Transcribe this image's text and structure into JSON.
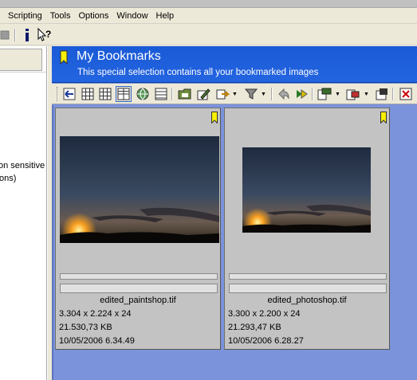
{
  "menu": [
    "Scripting",
    "Tools",
    "Options",
    "Window",
    "Help"
  ],
  "toolbar_icons": [
    "gray-square-icon",
    "info-icon",
    "whats-this-help-icon"
  ],
  "left_panel": {
    "text_lines": [
      "on sensitive",
      "ons)"
    ]
  },
  "banner": {
    "title": "My Bookmarks",
    "subtitle": "This special selection contains all your bookmarked images"
  },
  "view_toolbar_icons": [
    "go-back-icon",
    "grid-small-icon",
    "grid-medium-icon",
    "grid-large-icon",
    "globe-icon",
    "details-icon",
    "open-folder-icon",
    "edit-icon",
    "batch-icon",
    "filter-icon",
    "undo-icon",
    "next-icon",
    "copy-to-icon",
    "move-to-icon",
    "rotate-icon",
    "delete-icon"
  ],
  "images": [
    {
      "filename": "edited_paintshop.tif",
      "dimensions": "3.304 x 2.224 x 24",
      "size": "21.530,73 KB",
      "date": "10/05/2006 6.34.49"
    },
    {
      "filename": "edited_photoshop.tif",
      "dimensions": "3.300 x 2.200 x 24",
      "size": "21.293,47 KB",
      "date": "10/05/2006 6.28.27"
    }
  ],
  "colors": {
    "banner_blue": "#1f5fdc",
    "thumb_area_blue": "#7a93da",
    "bookmark_yellow": "#f8f000"
  }
}
